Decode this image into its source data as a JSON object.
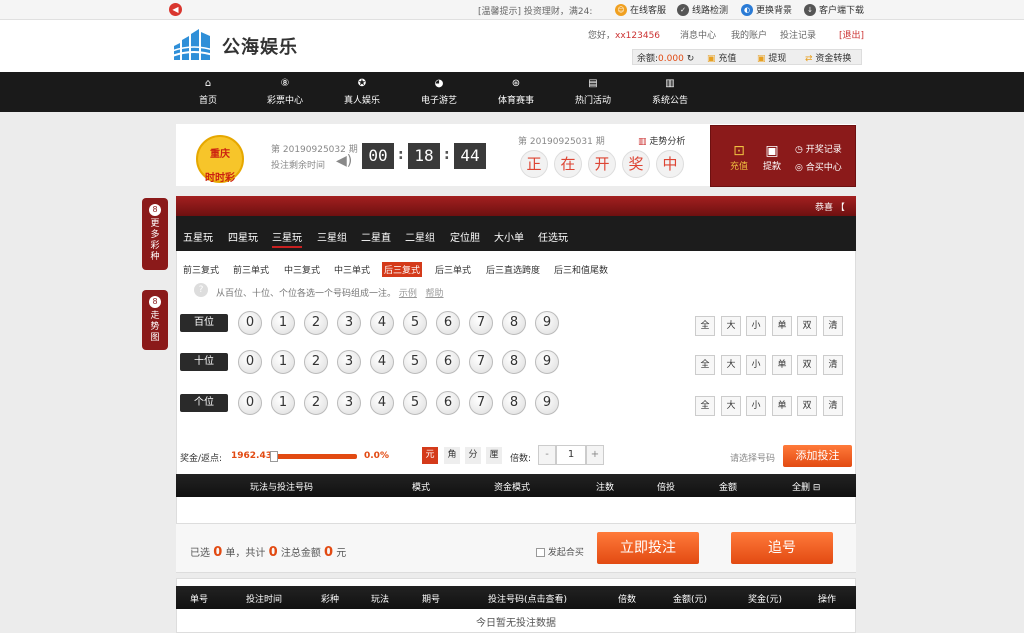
{
  "topbar": {
    "notice": "[温馨提示] 投资理财，满24:",
    "links": [
      "在线客服",
      "线路检测",
      "更换背景",
      "客户端下载"
    ]
  },
  "header": {
    "logo_text": "公海娱乐",
    "greeting": "您好，",
    "username": "xx123456",
    "links": [
      "消息中心",
      "我的账户",
      "投注记录",
      "[退出]"
    ],
    "balance_label": "余额:",
    "balance": "0.000",
    "actions": [
      "充值",
      "提现",
      "资金转换"
    ]
  },
  "nav": {
    "items": [
      {
        "label": "首页",
        "icon": "home-icon"
      },
      {
        "label": "彩票中心",
        "icon": "lottery-icon"
      },
      {
        "label": "真人娱乐",
        "icon": "casino-icon"
      },
      {
        "label": "电子游艺",
        "icon": "gamepad-icon"
      },
      {
        "label": "体育赛事",
        "icon": "ball-icon"
      },
      {
        "label": "热门活动",
        "icon": "gift-icon"
      },
      {
        "label": "系统公告",
        "icon": "notice-icon"
      }
    ]
  },
  "lottery": {
    "logo_line1": "重庆",
    "logo_line2": "时时彩",
    "current_period": "第 20190925032 期",
    "countdown_label": "投注剩余时间",
    "hh": "00",
    "mm": "18",
    "ss": "44",
    "last_period": "第 20190925031 期",
    "trend_link": "走势分析",
    "draw_status": [
      "正",
      "在",
      "开",
      "奖",
      "中"
    ],
    "panel": [
      "充值",
      "提款",
      "开奖记录",
      "合买中心"
    ]
  },
  "side_tabs": [
    "更多彩种",
    "走势图"
  ],
  "bet": {
    "header_right": "horizontal-guide",
    "header_right_label": "恭喜",
    "tabs": [
      "五星玩",
      "四星玩",
      "三星玩",
      "三星组",
      "二星直",
      "二星组",
      "定位胆",
      "大小单",
      "任选玩"
    ],
    "active_tab": 2,
    "subtabs": [
      "前三复式",
      "前三单式",
      "中三复式",
      "中三单式",
      "后三复式",
      "后三单式",
      "后三直选跨度",
      "后三和值尾数"
    ],
    "active_subtab": 4,
    "hint": "从百位、十位、个位各选一个号码组成一注。",
    "hint_links": [
      "示例",
      "帮助"
    ],
    "positions": [
      "百位",
      "十位",
      "个位"
    ],
    "numbers": [
      "0",
      "1",
      "2",
      "3",
      "4",
      "5",
      "6",
      "7",
      "8",
      "9"
    ],
    "quick": [
      "全",
      "大",
      "小",
      "单",
      "双",
      "清"
    ],
    "rebate_label": "奖金/返点:",
    "rebate_value": "1962.43",
    "rebate_percent": "0.0%",
    "units": [
      "元",
      "角",
      "分",
      "厘"
    ],
    "multiplier_label": "倍数:",
    "minus": "-",
    "multiplier": "1",
    "plus": "+",
    "select_hint": "请选择号码",
    "add_button": "添加投注",
    "cart_headers": [
      "玩法与投注号码",
      "模式",
      "资金模式",
      "注数",
      "倍投",
      "金额",
      "全删"
    ],
    "summary_prefix": "已选",
    "summary_count": "0",
    "summary_mid": "单，共计",
    "summary_bets": "0",
    "summary_mid2": "注总金额",
    "summary_amount": "0",
    "summary_suffix": "元",
    "joint_label": "发起合买",
    "submit_button": "立即投注",
    "chase_button": "追号"
  },
  "history": {
    "headers": [
      "单号",
      "投注时间",
      "彩种",
      "玩法",
      "期号",
      "投注号码(点击查看)",
      "倍数",
      "金额(元)",
      "奖金(元)",
      "操作"
    ],
    "empty": "今日暂无投注数据"
  },
  "colors": {
    "brand_red": "#8b1a1a",
    "accent_orange": "#e24a12",
    "nav_bg": "#1a1a1a"
  }
}
